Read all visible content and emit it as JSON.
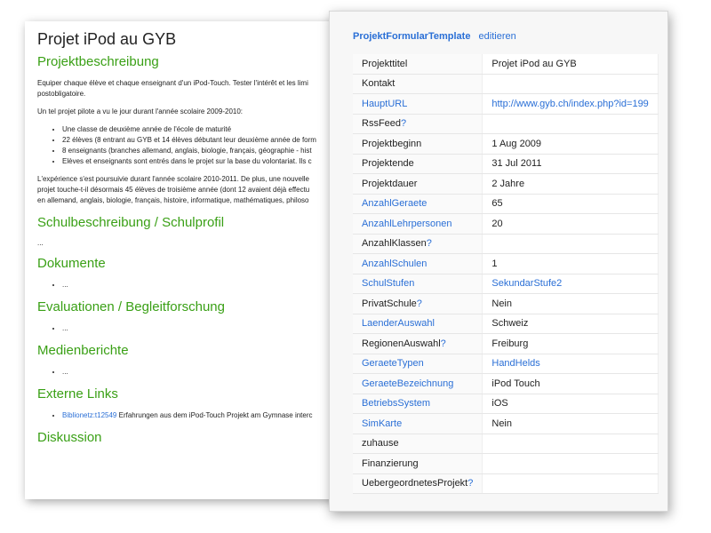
{
  "document": {
    "title": "Projet iPod au GYB",
    "sections": {
      "projekt": "Projektbeschreibung",
      "schul": "Schulbeschreibung / Schulprofil",
      "dokumente": "Dokumente",
      "evaluationen": "Evaluationen / Begleitforschung",
      "medien": "Medienberichte",
      "externe": "Externe Links",
      "diskussion": "Diskussion"
    },
    "para1": [
      "Equiper chaque élève et chaque enseignant d'un iPod-Touch. Tester l'intérêt et les limi",
      "postobligatoire."
    ],
    "para2": "Un tel projet pilote a vu le jour durant l'année scolaire 2009-2010:",
    "bullets": [
      "Une classe de deuxième année de l'école de maturité",
      "22 élèves (8 entrant au GYB et 14 élèves débutant leur deuxième année de form",
      "8 enseignants (branches allemand, anglais, biologie, français, géographie - hist",
      "Elèves et enseignants sont entrés dans le projet sur la base du volontariat. Ils c"
    ],
    "para3": [
      "L'expérience s'est poursuivie durant l'année scolaire 2010-2011. De plus, une nouvelle",
      "projet touche-t-il désormais 45 élèves de troisième année (dont 12 avaient déjà effectu",
      "en allemand, anglais, biologie, français, histoire, informatique, mathématiques, philoso"
    ],
    "ellipsis": "...",
    "link_text": "Biblionetz:t12549",
    "link_desc": "Erfahrungen aus dem iPod-Touch Projekt am Gymnase interc"
  },
  "panel": {
    "template_link": "ProjektFormularTemplate",
    "edit_link": "editieren",
    "rows": [
      {
        "key": "Projekttitel",
        "q": "",
        "value": "Projet iPod au GYB"
      },
      {
        "key": "Kontakt",
        "q": "",
        "value": ""
      },
      {
        "key": "HauptURL",
        "q": "",
        "value": "http://www.gyb.ch/index.php?id=199"
      },
      {
        "key": "RssFeed",
        "q": "?",
        "value": ""
      },
      {
        "key": "Projektbeginn",
        "q": "",
        "value": "1 Aug 2009"
      },
      {
        "key": "Projektende",
        "q": "",
        "value": "31 Jul 2011"
      },
      {
        "key": "Projektdauer",
        "q": "",
        "value": "2 Jahre"
      },
      {
        "key": "AnzahlGeraete",
        "q": "",
        "value": "65"
      },
      {
        "key": "AnzahlLehrpersonen",
        "q": "",
        "value": "20"
      },
      {
        "key": "AnzahlKlassen",
        "q": "?",
        "value": ""
      },
      {
        "key": "AnzahlSchulen",
        "q": "",
        "value": "1"
      },
      {
        "key": "SchulStufen",
        "q": "",
        "value": "SekundarStufe2"
      },
      {
        "key": "PrivatSchule",
        "q": "?",
        "value": "Nein"
      },
      {
        "key": "LaenderAuswahl",
        "q": "",
        "value": "Schweiz"
      },
      {
        "key": "RegionenAuswahl",
        "q": "?",
        "value": "Freiburg"
      },
      {
        "key": "GeraeteTypen",
        "q": "",
        "value": "HandHelds"
      },
      {
        "key": "GeraeteBezeichnung",
        "q": "",
        "value": "iPod Touch"
      },
      {
        "key": "BetriebsSystem",
        "q": "",
        "value": "iOS"
      },
      {
        "key": "SimKarte",
        "q": "",
        "value": "Nein"
      },
      {
        "key": "zuhause",
        "q": "",
        "value": ""
      },
      {
        "key": "Finanzierung",
        "q": "",
        "value": ""
      },
      {
        "key": "UebergeordnetesProjekt",
        "q": "?",
        "value": ""
      }
    ]
  },
  "colors": {
    "heading_green": "#3aa016",
    "link_blue": "#2a6fd6"
  }
}
